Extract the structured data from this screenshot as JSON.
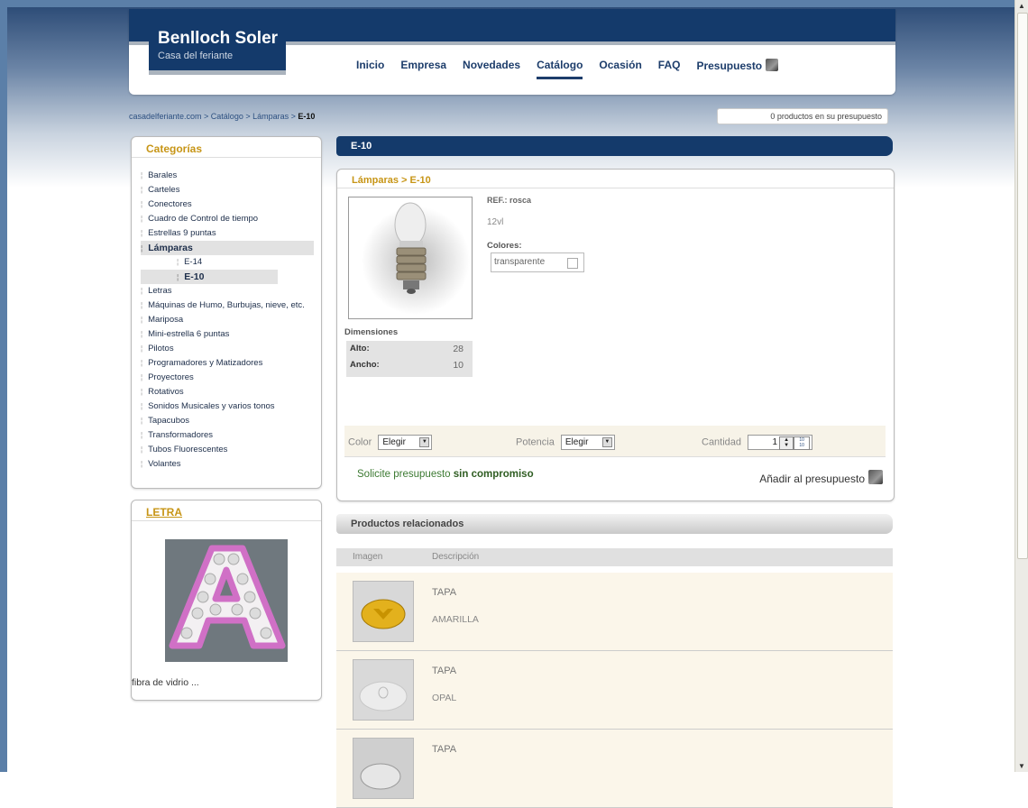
{
  "header": {
    "brand": "Benlloch Soler",
    "tagline": "Casa del feriante",
    "nav": [
      "Inicio",
      "Empresa",
      "Novedades",
      "Catálogo",
      "Ocasión",
      "FAQ",
      "Presupuesto"
    ],
    "active_nav": "Catálogo"
  },
  "breadcrumb": {
    "path": "casadelferiante.com > Catálogo > Lámparas > ",
    "current": "E-10"
  },
  "budget": {
    "count_text": "0 productos en su presupuesto"
  },
  "categories": {
    "title": "Categorías",
    "items": [
      "Barales",
      "Carteles",
      "Conectores",
      "Cuadro de Control de tiempo",
      "Estrellas 9 puntas",
      "Lámparas",
      "E-14",
      "E-10",
      "Letras",
      "Máquinas de Humo, Burbujas, nieve, etc.",
      "Mariposa",
      "Mini-estrella 6 puntas",
      "Pilotos",
      "Programadores y Matizadores",
      "Proyectores",
      "Rotativos",
      "Sonidos Musicales y varios tonos",
      "Tapacubos",
      "Transformadores",
      "Tubos Fluorescentes",
      "Volantes"
    ]
  },
  "feature": {
    "title": "LETRA",
    "caption": "fibra de vidrio ..."
  },
  "product": {
    "title": "E-10",
    "path": "Lámparas > E-10",
    "ref": "REF.: rosca",
    "voltage": "12vl",
    "colors_label": "Colores:",
    "color_option": "transparente",
    "dims_label": "Dimensiones",
    "dims": [
      {
        "k": "Alto:",
        "v": "28"
      },
      {
        "k": "Ancho:",
        "v": "10"
      }
    ],
    "options": {
      "color_label": "Color",
      "color_value": "Elegir",
      "power_label": "Potencia",
      "power_value": "Elegir",
      "qty_label": "Cantidad",
      "qty_value": "1"
    },
    "quote_text": "Solicite presupuesto",
    "quote_bold": "sin compromiso",
    "add_label": "Añadir al presupuesto"
  },
  "related": {
    "title": "Productos relacionados",
    "columns": [
      "Imagen",
      "Descripción"
    ],
    "rows": [
      {
        "name": "TAPA",
        "desc": "AMARILLA"
      },
      {
        "name": "TAPA",
        "desc": "OPAL"
      },
      {
        "name": "TAPA",
        "desc": ""
      }
    ]
  }
}
